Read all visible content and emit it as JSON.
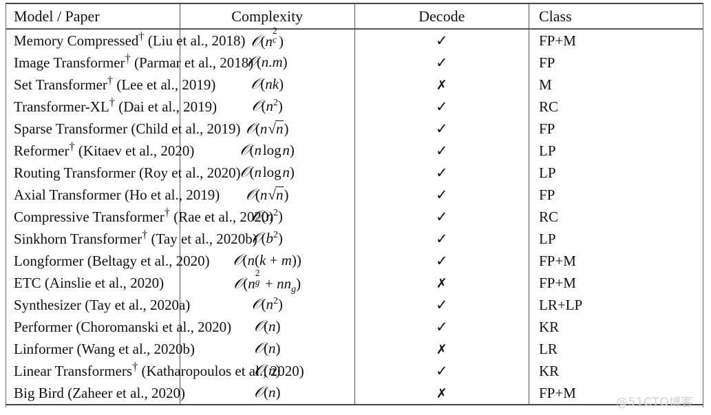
{
  "table": {
    "headers": {
      "model": "Model / Paper",
      "complexity": "Complexity",
      "decode": "Decode",
      "class": "Class"
    },
    "rows": [
      {
        "model_name": "Memory Compressed",
        "dagger": true,
        "citation": "(Liu et al., 2018)",
        "complexity_text": "O(n_c^2)",
        "decode": "✓",
        "decode_value": "yes",
        "class": "FP+M"
      },
      {
        "model_name": "Image Transformer",
        "dagger": true,
        "citation": "(Parmar et al., 2018)",
        "complexity_text": "O(n.m)",
        "decode": "✓",
        "decode_value": "yes",
        "class": "FP"
      },
      {
        "model_name": "Set Transformer",
        "dagger": true,
        "citation": "(Lee et al., 2019)",
        "complexity_text": "O(nk)",
        "decode": "✗",
        "decode_value": "no",
        "class": "M"
      },
      {
        "model_name": "Transformer-XL",
        "dagger": true,
        "citation": "(Dai et al., 2019)",
        "complexity_text": "O(n^2)",
        "decode": "✓",
        "decode_value": "yes",
        "class": "RC"
      },
      {
        "model_name": "Sparse Transformer",
        "dagger": false,
        "citation": "(Child et al., 2019)",
        "complexity_text": "O(n√n)",
        "decode": "✓",
        "decode_value": "yes",
        "class": "FP"
      },
      {
        "model_name": "Reformer",
        "dagger": true,
        "citation": "(Kitaev et al., 2020)",
        "complexity_text": "O(n log n)",
        "decode": "✓",
        "decode_value": "yes",
        "class": "LP"
      },
      {
        "model_name": "Routing Transformer",
        "dagger": false,
        "citation": "(Roy et al., 2020)",
        "complexity_text": "O(n log n)",
        "decode": "✓",
        "decode_value": "yes",
        "class": "LP"
      },
      {
        "model_name": "Axial Transformer",
        "dagger": false,
        "citation": "(Ho et al., 2019)",
        "complexity_text": "O(n√n)",
        "decode": "✓",
        "decode_value": "yes",
        "class": "FP"
      },
      {
        "model_name": "Compressive Transformer",
        "dagger": true,
        "citation": "(Rae et al., 2020)",
        "complexity_text": "O(n^2)",
        "decode": "✓",
        "decode_value": "yes",
        "class": "RC"
      },
      {
        "model_name": "Sinkhorn Transformer",
        "dagger": true,
        "citation": "(Tay et al., 2020b)",
        "complexity_text": "O(b^2)",
        "decode": "✓",
        "decode_value": "yes",
        "class": "LP"
      },
      {
        "model_name": "Longformer",
        "dagger": false,
        "citation": "(Beltagy et al., 2020)",
        "complexity_text": "O(n(k + m))",
        "decode": "✓",
        "decode_value": "yes",
        "class": "FP+M"
      },
      {
        "model_name": "ETC",
        "dagger": false,
        "citation": "(Ainslie et al., 2020)",
        "complexity_text": "O(n_g^2 + n n_g)",
        "decode": "✗",
        "decode_value": "no",
        "class": "FP+M"
      },
      {
        "model_name": "Synthesizer",
        "dagger": false,
        "citation": "(Tay et al., 2020a)",
        "complexity_text": "O(n^2)",
        "decode": "✓",
        "decode_value": "yes",
        "class": "LR+LP"
      },
      {
        "model_name": "Performer",
        "dagger": false,
        "citation": "(Choromanski et al., 2020)",
        "complexity_text": "O(n)",
        "decode": "✓",
        "decode_value": "yes",
        "class": "KR"
      },
      {
        "model_name": "Linformer",
        "dagger": false,
        "citation": "(Wang et al., 2020b)",
        "complexity_text": "O(n)",
        "decode": "✗",
        "decode_value": "no",
        "class": "LR"
      },
      {
        "model_name": "Linear Transformers",
        "dagger": true,
        "citation": "(Katharopoulos et al., 2020)",
        "complexity_text": "O(n)",
        "decode": "✓",
        "decode_value": "yes",
        "class": "KR"
      },
      {
        "model_name": "Big Bird",
        "dagger": false,
        "citation": "(Zaheer et al., 2020)",
        "complexity_text": "O(n)",
        "decode": "✗",
        "decode_value": "no",
        "class": "FP+M"
      }
    ]
  },
  "watermark": {
    "text": "@51CTO博客"
  },
  "symbols": {
    "dagger": "†",
    "check": "✓",
    "cross": "✗"
  }
}
